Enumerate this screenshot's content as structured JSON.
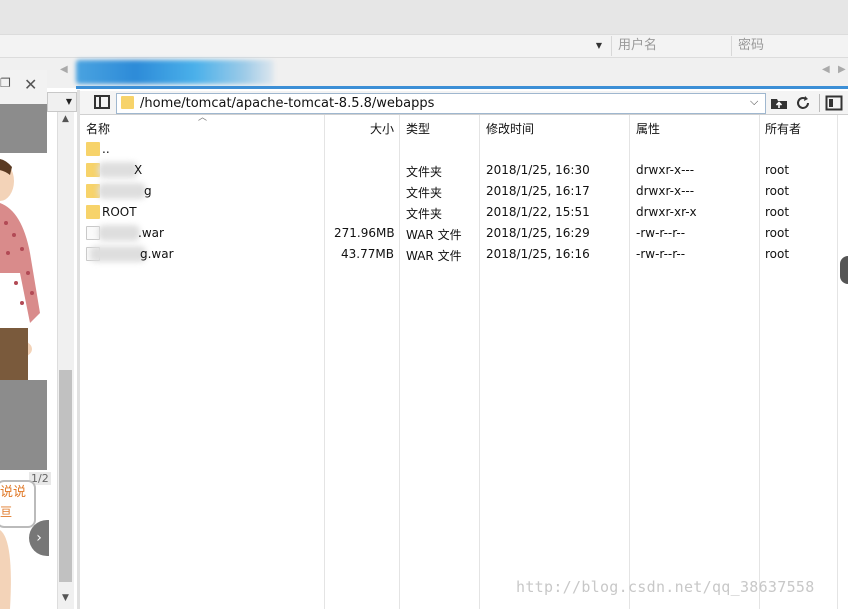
{
  "credentials": {
    "username_placeholder": "用户名",
    "password_placeholder": "密码"
  },
  "left_window": {
    "page_indicator": "1/2",
    "bubble_text": "说说",
    "bubble_sub": "亘"
  },
  "path_bar": {
    "path": "/home/tomcat/apache-tomcat-8.5.8/webapps"
  },
  "table": {
    "headers": {
      "name": "名称",
      "size": "大小",
      "type": "类型",
      "modified": "修改时间",
      "attributes": "属性",
      "owner": "所有者"
    },
    "rows": [
      {
        "icon": "folder-icon",
        "name": "..",
        "size": "",
        "type": "",
        "modified": "",
        "attributes": "",
        "owner": ""
      },
      {
        "icon": "folder-icon",
        "name": "X",
        "size": "",
        "type": "文件夹",
        "modified": "2018/1/25, 16:30",
        "attributes": "drwxr-x---",
        "owner": "root"
      },
      {
        "icon": "folder-icon",
        "name": "g",
        "size": "",
        "type": "文件夹",
        "modified": "2018/1/25, 16:17",
        "attributes": "drwxr-x---",
        "owner": "root"
      },
      {
        "icon": "folder-icon",
        "name": "ROOT",
        "size": "",
        "type": "文件夹",
        "modified": "2018/1/22, 15:51",
        "attributes": "drwxr-xr-x",
        "owner": "root"
      },
      {
        "icon": "file-icon",
        "name": ".war",
        "size": "271.96MB",
        "type": "WAR 文件",
        "modified": "2018/1/25, 16:29",
        "attributes": "-rw-r--r--",
        "owner": "root"
      },
      {
        "icon": "file-icon",
        "name": "g.war",
        "size": "43.77MB",
        "type": "WAR 文件",
        "modified": "2018/1/25, 16:16",
        "attributes": "-rw-r--r--",
        "owner": "root"
      }
    ]
  },
  "watermark": "http://blog.csdn.net/qq_38637558"
}
